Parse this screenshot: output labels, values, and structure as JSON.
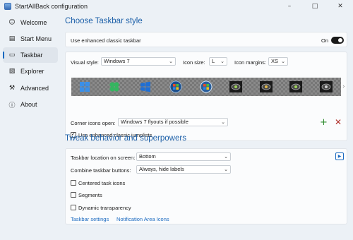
{
  "window": {
    "title": "StartAllBack configuration",
    "controls": [
      "–",
      "□",
      "✕"
    ]
  },
  "sidebar": {
    "items": [
      {
        "label": "Welcome",
        "icon": "smiley-icon",
        "glyph": "☺"
      },
      {
        "label": "Start Menu",
        "icon": "start-menu-icon",
        "glyph": "▤"
      },
      {
        "label": "Taskbar",
        "icon": "taskbar-icon",
        "glyph": "▭",
        "active": true
      },
      {
        "label": "Explorer",
        "icon": "folder-icon",
        "glyph": "▧"
      },
      {
        "label": "Advanced",
        "icon": "wrench-icon",
        "glyph": "⚒"
      },
      {
        "label": "About",
        "icon": "info-icon",
        "glyph": "ⓘ"
      }
    ]
  },
  "taskbar_style": {
    "heading": "Choose Taskbar style",
    "enhanced_classic": {
      "label": "Use enhanced classic taskbar",
      "state_label": "On",
      "on": true
    },
    "visual_style": {
      "label": "Visual style:",
      "value": "Windows 7"
    },
    "icon_size": {
      "label": "Icon size:",
      "value": "L"
    },
    "icon_margins": {
      "label": "Icon margins:",
      "value": "XS"
    },
    "previews": [
      "windows-11-start-icon",
      "windows-10-clover-start-icon",
      "windows-10-start-icon",
      "windows-7-orb-icon",
      "windows-vista-orb-icon",
      "classic-orb-icon",
      "classic-orb-icon",
      "classic-orb-icon",
      "classic-orb-icon"
    ],
    "corner_icons": {
      "label": "Corner icons open:",
      "value": "Windows 7 flyouts if possible"
    },
    "jumplists": {
      "label": "Use enhanced classic jumplists",
      "checked": true
    }
  },
  "tweaks": {
    "heading": "Tweak behavior and superpowers",
    "location": {
      "label": "Taskbar location on screen:",
      "value": "Bottom"
    },
    "combine": {
      "label": "Combine taskbar buttons:",
      "value": "Always, hide labels"
    },
    "options": [
      {
        "label": "Centered task icons",
        "checked": false
      },
      {
        "label": "Segments",
        "checked": false
      },
      {
        "label": "Dynamic transparency",
        "checked": false
      }
    ],
    "links": [
      "Taskbar settings",
      "Notification Area Icons"
    ]
  },
  "colors": {
    "accent": "#1b5fa8",
    "link": "#1b6ac0",
    "add": "#2e8b2e",
    "remove": "#b0302a"
  }
}
